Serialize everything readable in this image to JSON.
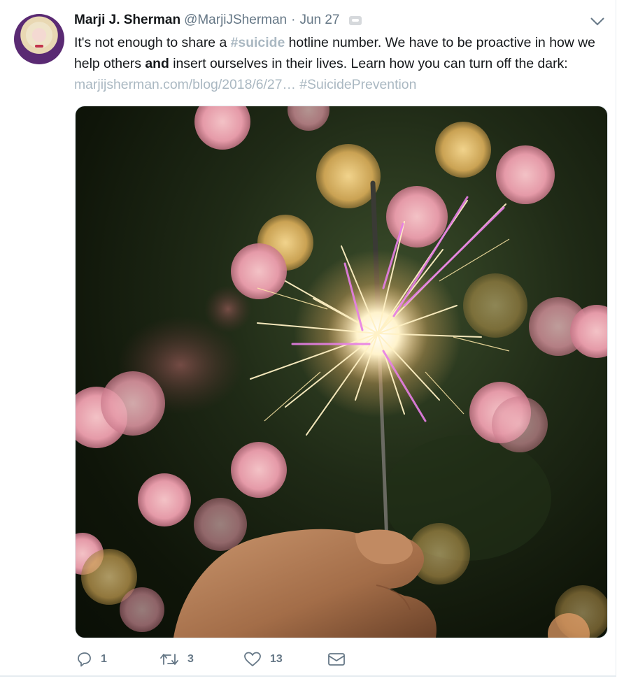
{
  "tweet": {
    "name": "Marji J. Sherman",
    "handle": "@MarjiJSherman",
    "separator": "·",
    "date": "Jun 27",
    "text": {
      "p1": "It's not enough to share a ",
      "hashtag1": "#suicide",
      "p2": " hotline number. We have to be proactive in how we help others ",
      "bold": "and",
      "p3": " insert ourselves in their lives. Learn how you can turn off the dark: ",
      "link": "marjijsherman.com/blog/2018/6/27…",
      "space": " ",
      "hashtag2": "#SuicidePrevention"
    }
  },
  "actions": {
    "reply_count": "1",
    "retweet_count": "3",
    "like_count": "13"
  },
  "icons": {
    "reply": "reply-icon",
    "retweet": "retweet-icon",
    "like": "heart-icon",
    "dm": "envelope-icon",
    "menu": "chevron-down-icon"
  },
  "colors": {
    "text": "#14171a",
    "muted": "#657786",
    "link": "#aab8c2",
    "border": "#e6ecf0"
  }
}
